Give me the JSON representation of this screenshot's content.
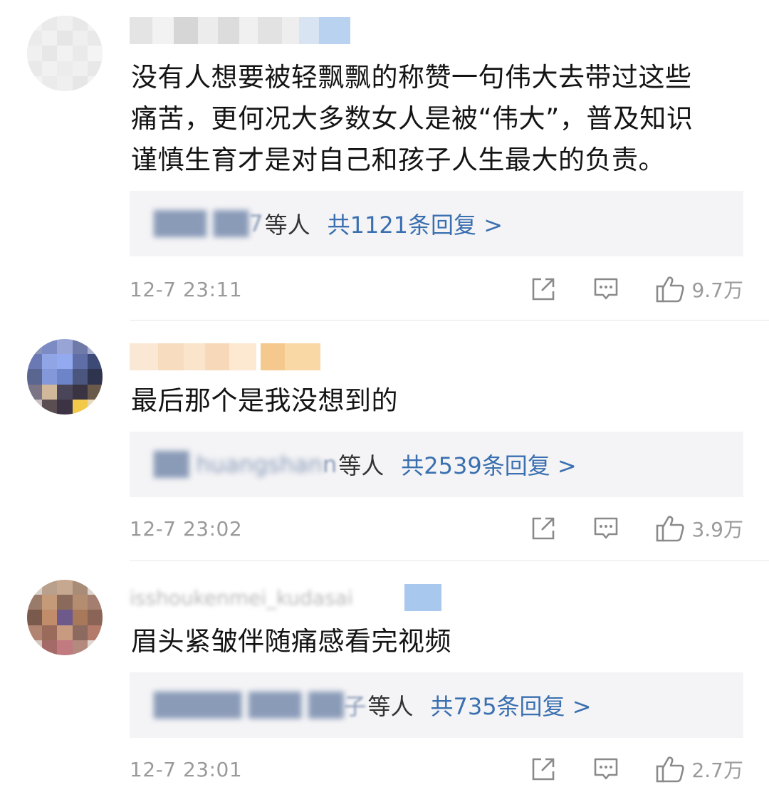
{
  "comments": [
    {
      "username": "",
      "text_lines": [
        "没有人想要被轻飘飘的称赞一句伟大去带过这些",
        "痛苦，更何况大多数女人是被“伟大”，普及知识",
        "谨慎生育才是对自己和孩子人生最大的负责。"
      ],
      "reply_names": "███ ██",
      "reply_tail": "7",
      "reply_etc": "等人",
      "reply_count_label": "共1121条回复 >",
      "time": "12-7 23:11",
      "likes": "9.7万",
      "share_icon": "share-icon",
      "comment_icon": "comment-icon",
      "like_icon": "thumbs-up-icon"
    },
    {
      "username": "",
      "text_lines": [
        "最后那个是我没想到的"
      ],
      "reply_names": "██ huangshan",
      "reply_tail": "n",
      "reply_etc": "等人",
      "reply_count_label": "共2539条回复 >",
      "time": "12-7 23:02",
      "likes": "3.9万",
      "share_icon": "share-icon",
      "comment_icon": "comment-icon",
      "like_icon": "thumbs-up-icon"
    },
    {
      "username": "isshoukenmei_kudasai",
      "text_lines": [
        "眉头紧皱伴随痛感看完视频"
      ],
      "reply_names": "█████ ███ ██",
      "reply_tail": "子",
      "reply_etc": "等人",
      "reply_count_label": "共735条回复 >",
      "time": "12-7 23:01",
      "likes": "2.7万",
      "share_icon": "share-icon",
      "comment_icon": "comment-icon",
      "like_icon": "thumbs-up-icon"
    }
  ],
  "colors": {
    "reply_count": "#3a6fb0",
    "reply_box_bg": "#f4f4f6",
    "meta_text": "#9a9a9a",
    "body_text": "#141414"
  }
}
